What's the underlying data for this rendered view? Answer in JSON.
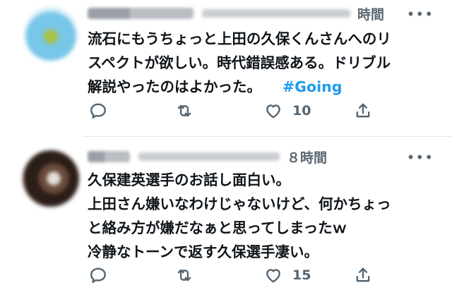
{
  "tweets": [
    {
      "time": "時間",
      "more_icon": "ellipsis-icon",
      "lines": [
        "流石にもうちょっと上田の久保くんさんへのリ",
        "スペクトが欲しい。時代錯誤感ある。ドリブル",
        "解説やったのはよかった。"
      ],
      "hashtag": "#Going",
      "like_count": "10"
    },
    {
      "time": "８時間",
      "more_icon": "ellipsis-icon",
      "lines": [
        "久保建英選手のお話し面白い。",
        "上田さん嫌いなわけじゃないけど、何かちょっ",
        "と絡み方が嫌だなぁと思ってしまったｗ",
        "冷静なトーンで返す久保選手凄い。"
      ],
      "like_count": "15"
    }
  ],
  "colors": {
    "hashtag": "#1d9bf0",
    "icon": "#536471",
    "text": "#0f1419"
  }
}
